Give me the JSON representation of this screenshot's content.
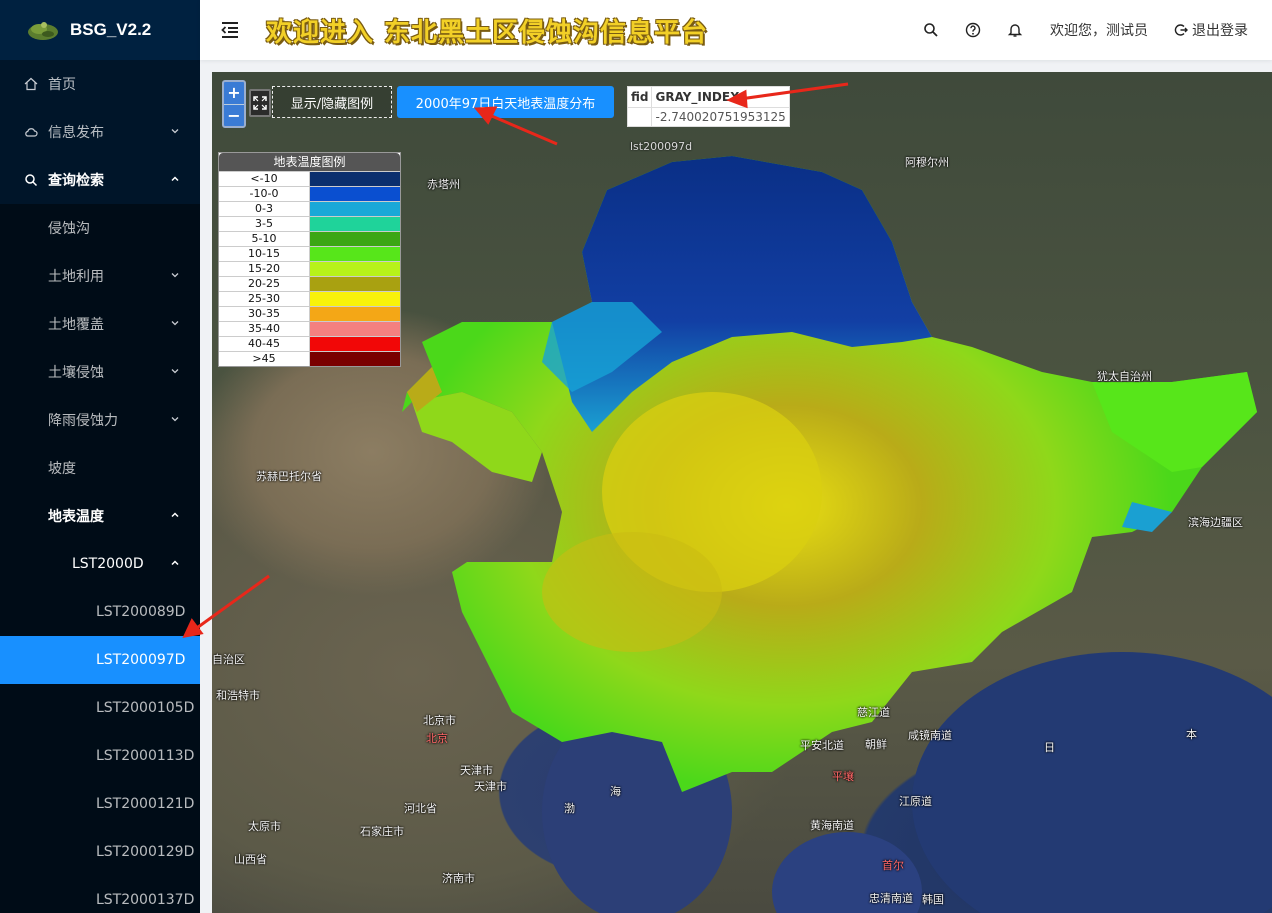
{
  "brand": {
    "name": "BSG_V2.2"
  },
  "header": {
    "title": "欢迎进入 东北黑土区侵蚀沟信息平台",
    "welcome": "欢迎您，测试员",
    "logout": "退出登录"
  },
  "sidebar": {
    "items": [
      {
        "label": "首页"
      },
      {
        "label": "信息发布"
      },
      {
        "label": "查询检索"
      },
      {
        "label": "侵蚀沟"
      },
      {
        "label": "土地利用"
      },
      {
        "label": "土地覆盖"
      },
      {
        "label": "土壤侵蚀"
      },
      {
        "label": "降雨侵蚀力"
      },
      {
        "label": "坡度"
      },
      {
        "label": "地表温度"
      },
      {
        "label": "LST2000D"
      },
      {
        "label": "LST200089D"
      },
      {
        "label": "LST200097D"
      },
      {
        "label": "LST2000105D"
      },
      {
        "label": "LST2000113D"
      },
      {
        "label": "LST2000121D"
      },
      {
        "label": "LST2000129D"
      },
      {
        "label": "LST2000137D"
      }
    ]
  },
  "map": {
    "zoom_in": "+",
    "zoom_out": "−",
    "toggle_legend": "显示/隐藏图例",
    "layer_button": "2000年97日白天地表温度分布",
    "attr_table": {
      "col1": "fid",
      "col2": "GRAY_INDEX",
      "value": "-2.740020751953125"
    },
    "attr_layer": "lst200097d",
    "legend": {
      "title": "地表温度图例",
      "rows": [
        {
          "label": "<-10",
          "color": "#0b2f6e"
        },
        {
          "label": "-10-0",
          "color": "#0a4fd0"
        },
        {
          "label": "0-3",
          "color": "#1aa8d8"
        },
        {
          "label": "3-5",
          "color": "#1fd39a"
        },
        {
          "label": "5-10",
          "color": "#3ca614"
        },
        {
          "label": "10-15",
          "color": "#57e61a"
        },
        {
          "label": "15-20",
          "color": "#b7f21a"
        },
        {
          "label": "20-25",
          "color": "#a9a111"
        },
        {
          "label": "25-30",
          "color": "#f8f20a"
        },
        {
          "label": "30-35",
          "color": "#f4a716"
        },
        {
          "label": "35-40",
          "color": "#f48080"
        },
        {
          "label": "40-45",
          "color": "#f20707"
        },
        {
          "label": ">45",
          "color": "#7a0000"
        }
      ]
    },
    "places": [
      {
        "name": "赤塔州"
      },
      {
        "name": "阿穆尔州"
      },
      {
        "name": "犹太自治州"
      },
      {
        "name": "苏赫巴托尔省"
      },
      {
        "name": "滨海边疆区"
      },
      {
        "name": "自治区"
      },
      {
        "name": "和浩特市"
      },
      {
        "name": "北京市"
      },
      {
        "name": "北京"
      },
      {
        "name": "天津市"
      },
      {
        "name": "天津市"
      },
      {
        "name": "河北省"
      },
      {
        "name": "太原市"
      },
      {
        "name": "石家庄市"
      },
      {
        "name": "山西省"
      },
      {
        "name": "济南市"
      },
      {
        "name": "慈江道"
      },
      {
        "name": "朝鲜"
      },
      {
        "name": "平安北道"
      },
      {
        "name": "咸镜南道"
      },
      {
        "name": "平壤"
      },
      {
        "name": "黄海南道"
      },
      {
        "name": "江原道"
      },
      {
        "name": "首尔"
      },
      {
        "name": "忠清南道"
      },
      {
        "name": "韩国"
      },
      {
        "name": "渤"
      },
      {
        "name": "海"
      },
      {
        "name": "日"
      },
      {
        "name": "本"
      }
    ]
  }
}
